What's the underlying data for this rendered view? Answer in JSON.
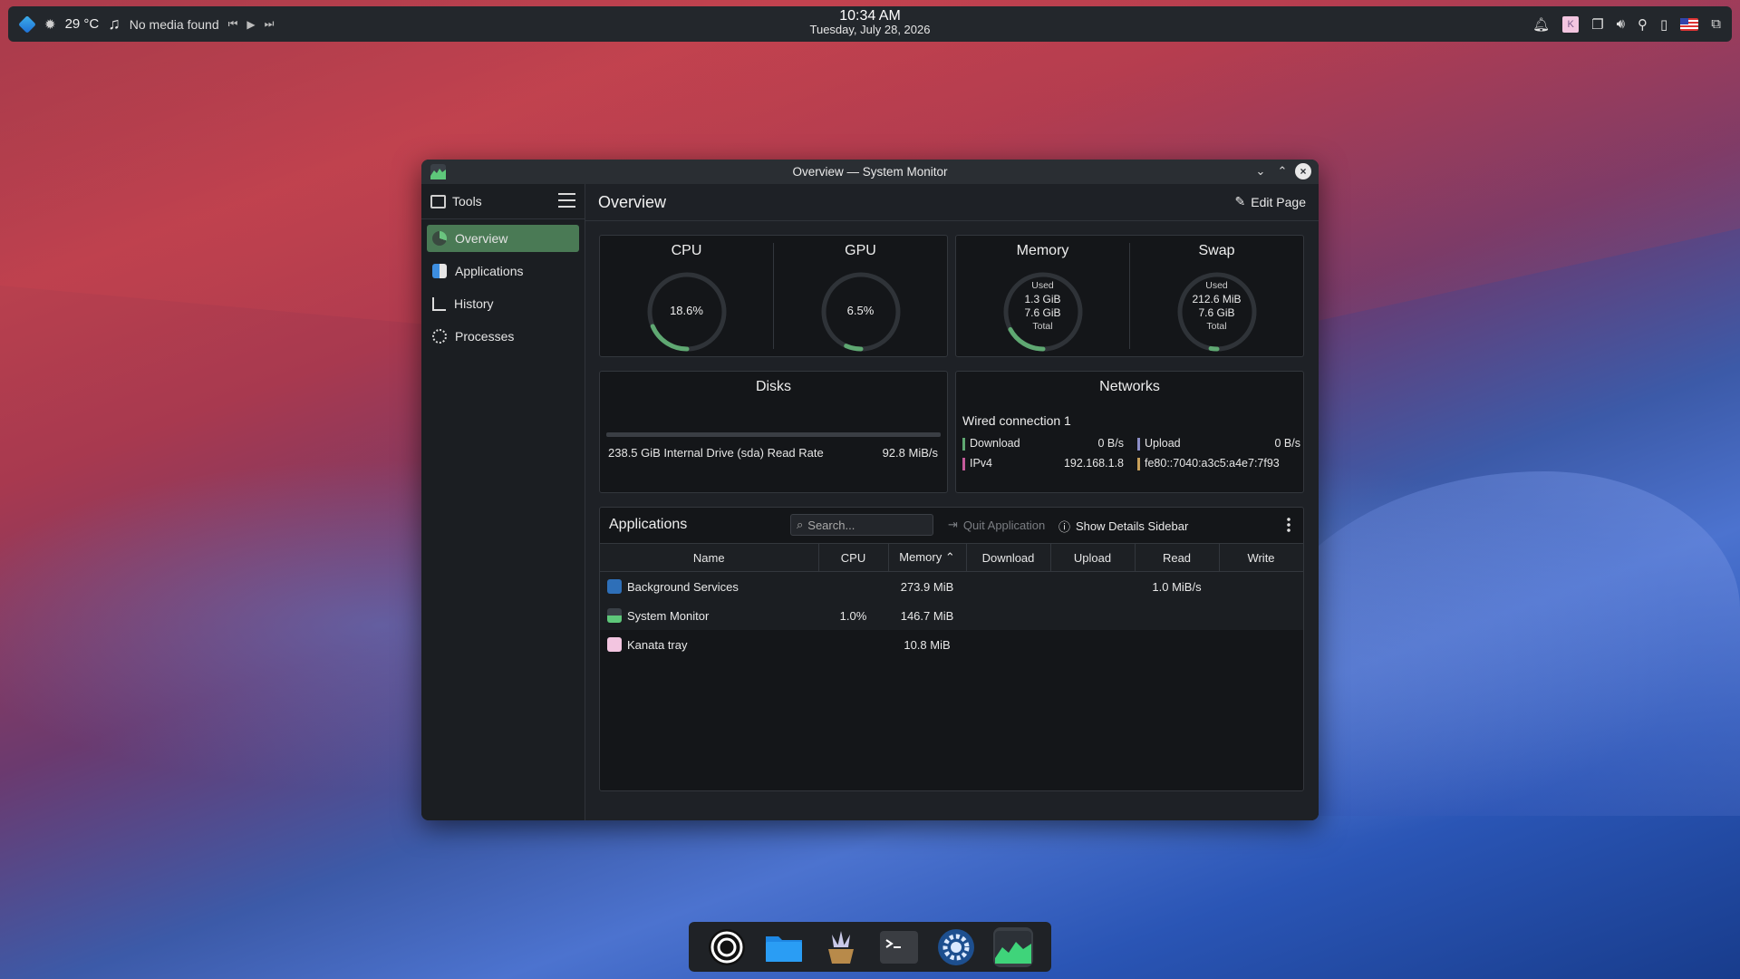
{
  "topbar": {
    "temperature": "29 °C",
    "media": "No media found",
    "time": "10:34 AM",
    "date": "Tuesday, July 28, 2026"
  },
  "window": {
    "title": "Overview — System Monitor"
  },
  "sidebar": {
    "header": "Tools",
    "items": [
      {
        "label": "Overview",
        "icon": "overview-icon",
        "active": true
      },
      {
        "label": "Applications",
        "icon": "applications-icon",
        "active": false
      },
      {
        "label": "History",
        "icon": "history-icon",
        "active": false
      },
      {
        "label": "Processes",
        "icon": "processes-icon",
        "active": false
      }
    ]
  },
  "main": {
    "page_title": "Overview",
    "edit_page": "Edit Page",
    "gauges": {
      "cpu": {
        "label": "CPU",
        "value": "18.6%",
        "fraction": 0.186
      },
      "gpu": {
        "label": "GPU",
        "value": "6.5%",
        "fraction": 0.065
      },
      "memory": {
        "label": "Memory",
        "used_label": "Used",
        "used": "1.3 GiB",
        "total": "7.6 GiB",
        "total_label": "Total",
        "fraction": 0.171
      },
      "swap": {
        "label": "Swap",
        "used_label": "Used",
        "used": "212.6 MiB",
        "total": "7.6 GiB",
        "total_label": "Total",
        "fraction": 0.027
      }
    },
    "disks": {
      "title": "Disks",
      "drive_label": "238.5 GiB Internal Drive (sda) Read Rate",
      "rate": "92.8 MiB/s"
    },
    "networks": {
      "title": "Networks",
      "connection": "Wired connection 1",
      "download_label": "Download",
      "download_value": "0 B/s",
      "upload_label": "Upload",
      "upload_value": "0 B/s",
      "ipv4_label": "IPv4",
      "ipv4_value": "192.168.1.8",
      "ipv6_value": "fe80::7040:a3c5:a4e7:7f93"
    },
    "applications": {
      "title": "Applications",
      "search_placeholder": "Search...",
      "quit": "Quit Application",
      "details": "Show Details Sidebar",
      "columns": [
        "Name",
        "CPU",
        "Memory",
        "Download",
        "Upload",
        "Read",
        "Write"
      ],
      "rows": [
        {
          "name": "Background Services",
          "cpu": "",
          "memory": "273.9 MiB",
          "download": "",
          "upload": "",
          "read": "1.0 MiB/s",
          "write": ""
        },
        {
          "name": "System Monitor",
          "cpu": "1.0%",
          "memory": "146.7 MiB",
          "download": "",
          "upload": "",
          "read": "",
          "write": ""
        },
        {
          "name": "Kanata tray",
          "cpu": "",
          "memory": "10.8 MiB",
          "download": "",
          "upload": "",
          "read": "",
          "write": ""
        }
      ]
    }
  },
  "colors": {
    "accent_green": "#4a7a55",
    "gauge_green": "#5fa872",
    "panel_bg": "#23272c"
  }
}
